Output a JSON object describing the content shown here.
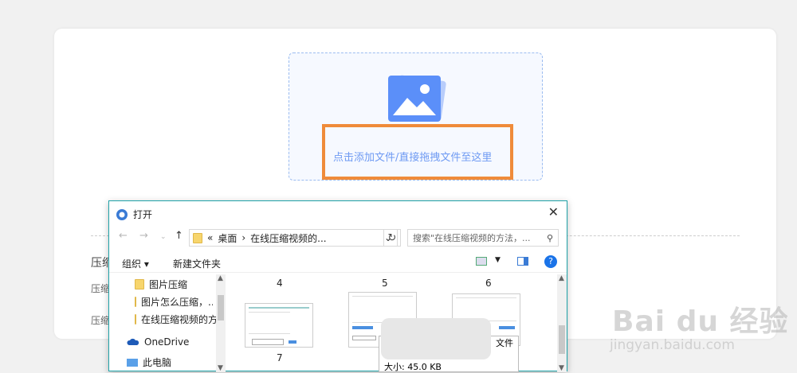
{
  "upload": {
    "drop_text": "点击添加文件/直接拖拽文件至这里"
  },
  "behind_labels": [
    "压缩",
    "压缩",
    "压缩"
  ],
  "dialog": {
    "title": "打开",
    "close": "✕",
    "breadcrumb": {
      "sep1": "«",
      "seg1": "桌面",
      "sep2": "›",
      "seg2": "在线压缩视频的..."
    },
    "search_placeholder": "搜索\"在线压缩视频的方法，...",
    "toolbar": {
      "organize": "组织 ▾",
      "new_folder": "新建文件夹"
    },
    "tree": [
      {
        "label": "图片压缩"
      },
      {
        "label": "图片怎么压缩，..."
      },
      {
        "label": "在线压缩视频的方"
      },
      {
        "label": "OneDrive"
      },
      {
        "label": "此电脑"
      }
    ],
    "files": [
      {
        "name": "4"
      },
      {
        "name": "5"
      },
      {
        "name": "6"
      },
      {
        "name": "7"
      }
    ],
    "tooltip": {
      "partial": "文件",
      "size": "大小: 45.0 KB"
    }
  },
  "watermark": {
    "brand": "Bai du 经验",
    "url": "jingyan.baidu.com"
  },
  "colors": {
    "accent": "#5b8ff9",
    "highlight": "#ef8b3a",
    "dialog_border": "#1fa2a8"
  }
}
